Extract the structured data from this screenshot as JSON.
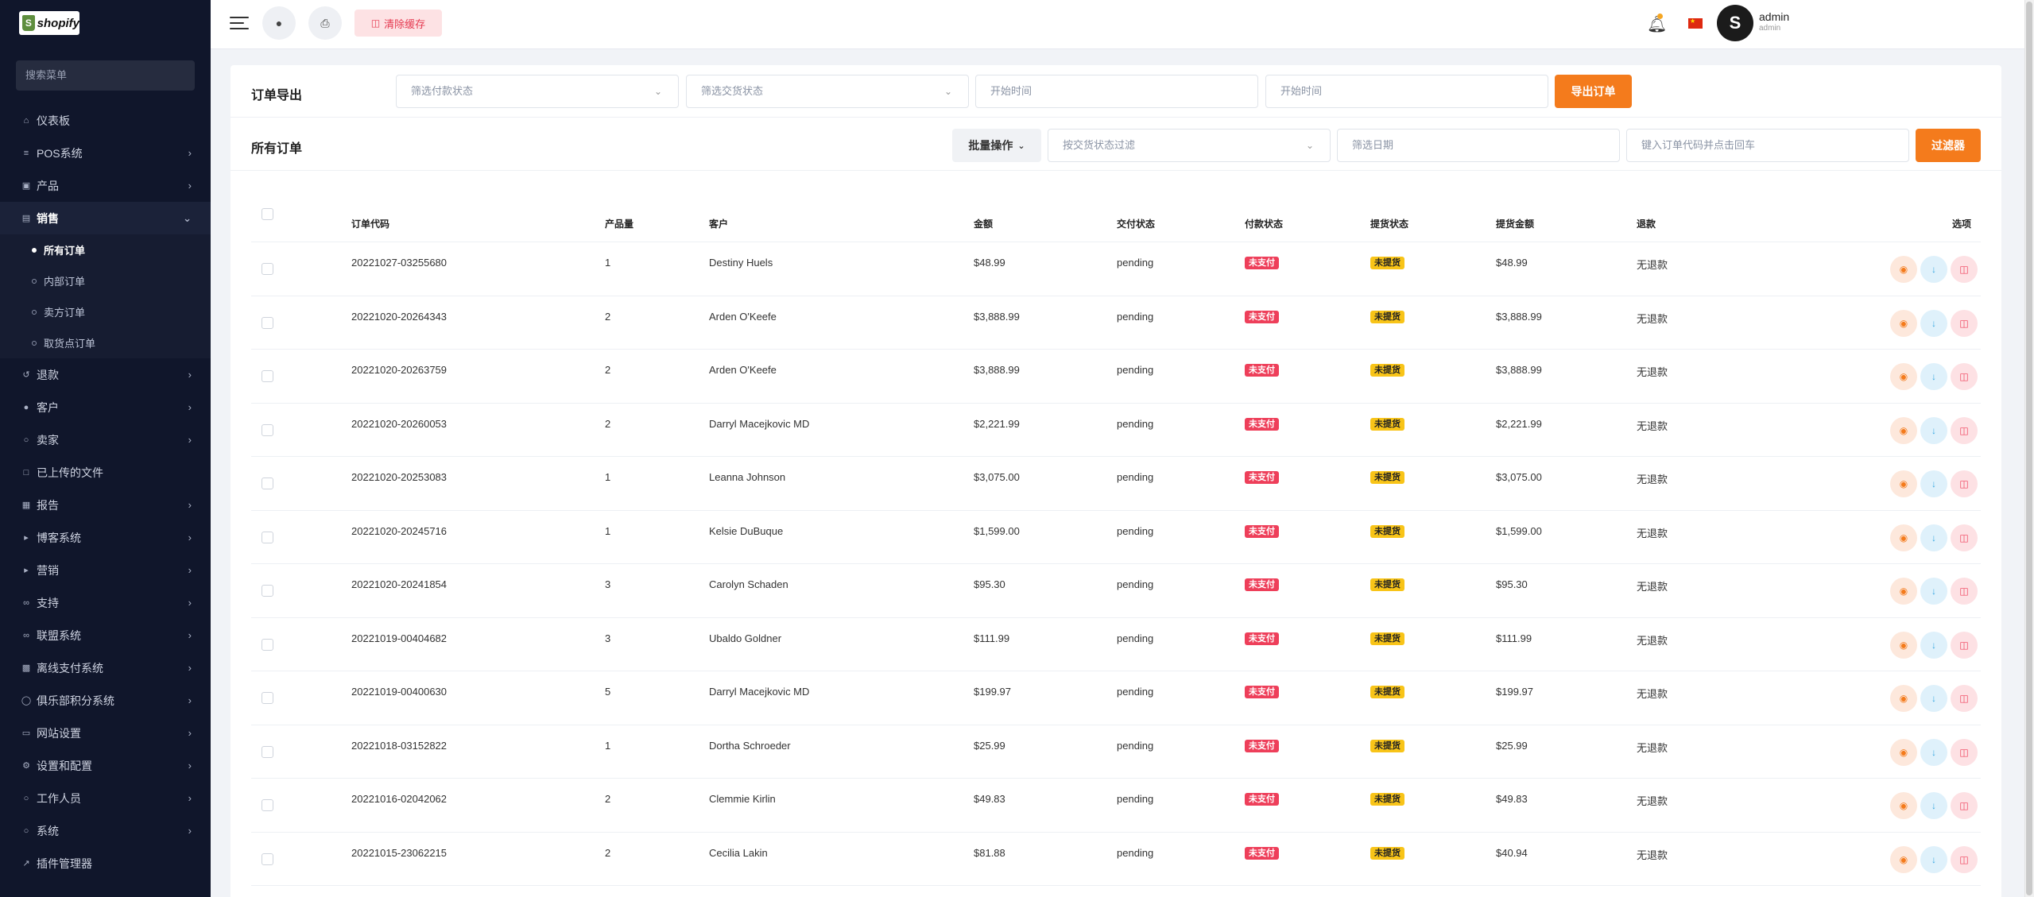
{
  "brand": {
    "logo_text": "shopify"
  },
  "sidebar": {
    "search_placeholder": "搜索菜单",
    "items": [
      {
        "label": "仪表板",
        "icon": "home-icon",
        "has_children": false
      },
      {
        "label": "POS系统",
        "icon": "list-icon",
        "has_children": true
      },
      {
        "label": "产品",
        "icon": "cart-icon",
        "has_children": true
      },
      {
        "label": "销售",
        "icon": "chart-icon",
        "has_children": true,
        "expanded": true,
        "children": [
          {
            "label": "所有订单",
            "current": true
          },
          {
            "label": "内部订单",
            "current": false
          },
          {
            "label": "卖方订单",
            "current": false
          },
          {
            "label": "取货点订单",
            "current": false
          }
        ]
      },
      {
        "label": "退款",
        "icon": "refund-icon",
        "has_children": true
      },
      {
        "label": "客户",
        "icon": "users-icon",
        "has_children": true
      },
      {
        "label": "卖家",
        "icon": "user-icon",
        "has_children": true
      },
      {
        "label": "已上传的文件",
        "icon": "file-icon",
        "has_children": false
      },
      {
        "label": "报告",
        "icon": "report-icon",
        "has_children": true
      },
      {
        "label": "博客系统",
        "icon": "megaphone-icon",
        "has_children": true
      },
      {
        "label": "营销",
        "icon": "megaphone-icon",
        "has_children": true
      },
      {
        "label": "支持",
        "icon": "link-icon",
        "has_children": true
      },
      {
        "label": "联盟系统",
        "icon": "link-icon",
        "has_children": true
      },
      {
        "label": "离线支付系统",
        "icon": "money-icon",
        "has_children": true
      },
      {
        "label": "俱乐部积分系统",
        "icon": "coin-icon",
        "has_children": true
      },
      {
        "label": "网站设置",
        "icon": "monitor-icon",
        "has_children": true
      },
      {
        "label": "设置和配置",
        "icon": "gear-icon",
        "has_children": true
      },
      {
        "label": "工作人员",
        "icon": "user-icon",
        "has_children": true
      },
      {
        "label": "系统",
        "icon": "user-icon",
        "has_children": true
      },
      {
        "label": "插件管理器",
        "icon": "wrench-icon",
        "has_children": false
      }
    ]
  },
  "header": {
    "clear_cache_label": "清除缓存",
    "user_name": "admin",
    "user_role": "admin",
    "avatar_letter": "S"
  },
  "export": {
    "title": "订单导出",
    "payment_status_placeholder": "筛选付款状态",
    "delivery_status_placeholder": "筛选交货状态",
    "start_time_placeholder": "开始时间",
    "end_time_placeholder": "开始时间",
    "export_button": "导出订单"
  },
  "orders": {
    "title": "所有订单",
    "bulk_action": "批量操作",
    "delivery_filter_placeholder": "按交货状态过滤",
    "date_filter_placeholder": "筛选日期",
    "code_search_placeholder": "键入订单代码并点击回车",
    "filter_button": "过滤器",
    "columns": [
      "订单代码",
      "产品量",
      "客户",
      "金额",
      "交付状态",
      "付款状态",
      "提货状态",
      "提货金额",
      "退款",
      "选项"
    ],
    "rows": [
      {
        "code": "20221027-03255680",
        "qty": "1",
        "customer": "Destiny Huels",
        "amount": "$48.99",
        "delivery": "pending",
        "payment": "未支付",
        "pickup": "未提货",
        "pickup_amount": "$48.99",
        "refund": "无退款"
      },
      {
        "code": "20221020-20264343",
        "qty": "2",
        "customer": "Arden O'Keefe",
        "amount": "$3,888.99",
        "delivery": "pending",
        "payment": "未支付",
        "pickup": "未提货",
        "pickup_amount": "$3,888.99",
        "refund": "无退款"
      },
      {
        "code": "20221020-20263759",
        "qty": "2",
        "customer": "Arden O'Keefe",
        "amount": "$3,888.99",
        "delivery": "pending",
        "payment": "未支付",
        "pickup": "未提货",
        "pickup_amount": "$3,888.99",
        "refund": "无退款"
      },
      {
        "code": "20221020-20260053",
        "qty": "2",
        "customer": "Darryl Macejkovic MD",
        "amount": "$2,221.99",
        "delivery": "pending",
        "payment": "未支付",
        "pickup": "未提货",
        "pickup_amount": "$2,221.99",
        "refund": "无退款"
      },
      {
        "code": "20221020-20253083",
        "qty": "1",
        "customer": "Leanna Johnson",
        "amount": "$3,075.00",
        "delivery": "pending",
        "payment": "未支付",
        "pickup": "未提货",
        "pickup_amount": "$3,075.00",
        "refund": "无退款"
      },
      {
        "code": "20221020-20245716",
        "qty": "1",
        "customer": "Kelsie DuBuque",
        "amount": "$1,599.00",
        "delivery": "pending",
        "payment": "未支付",
        "pickup": "未提货",
        "pickup_amount": "$1,599.00",
        "refund": "无退款"
      },
      {
        "code": "20221020-20241854",
        "qty": "3",
        "customer": "Carolyn Schaden",
        "amount": "$95.30",
        "delivery": "pending",
        "payment": "未支付",
        "pickup": "未提货",
        "pickup_amount": "$95.30",
        "refund": "无退款"
      },
      {
        "code": "20221019-00404682",
        "qty": "3",
        "customer": "Ubaldo Goldner",
        "amount": "$111.99",
        "delivery": "pending",
        "payment": "未支付",
        "pickup": "未提货",
        "pickup_amount": "$111.99",
        "refund": "无退款"
      },
      {
        "code": "20221019-00400630",
        "qty": "5",
        "customer": "Darryl Macejkovic MD",
        "amount": "$199.97",
        "delivery": "pending",
        "payment": "未支付",
        "pickup": "未提货",
        "pickup_amount": "$199.97",
        "refund": "无退款"
      },
      {
        "code": "20221018-03152822",
        "qty": "1",
        "customer": "Dortha Schroeder",
        "amount": "$25.99",
        "delivery": "pending",
        "payment": "未支付",
        "pickup": "未提货",
        "pickup_amount": "$25.99",
        "refund": "无退款"
      },
      {
        "code": "20221016-02042062",
        "qty": "2",
        "customer": "Clemmie Kirlin",
        "amount": "$49.83",
        "delivery": "pending",
        "payment": "未支付",
        "pickup": "未提货",
        "pickup_amount": "$49.83",
        "refund": "无退款"
      },
      {
        "code": "20221015-23062215",
        "qty": "2",
        "customer": "Cecilia Lakin",
        "amount": "$81.88",
        "delivery": "pending",
        "payment": "未支付",
        "pickup": "未提货",
        "pickup_amount": "$40.94",
        "refund": "无退款"
      }
    ]
  },
  "colors": {
    "accent": "#f47b1c",
    "sidebar_bg": "#10162b",
    "unpaid_badge": "#ee3f5a",
    "not_picked_badge": "#f8c418"
  }
}
